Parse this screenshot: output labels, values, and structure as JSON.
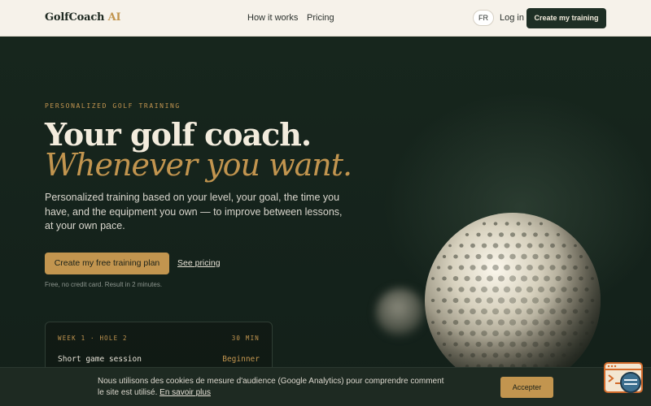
{
  "nav": {
    "logo_main": "GolfCoach",
    "logo_ai": "AI",
    "links": [
      "How it works",
      "Pricing"
    ],
    "lang": "FR",
    "login": "Log in",
    "cta": "Create my training"
  },
  "hero": {
    "eyebrow": "PERSONALIZED GOLF TRAINING",
    "title_line1": "Your golf coach.",
    "title_line2": "Whenever you want.",
    "subtitle": "Personalized training based on your level, your goal, the time you have, and the equipment you own — to improve between lessons, at your own pace.",
    "cta_primary": "Create my free training plan",
    "cta_secondary": "See pricing",
    "note": "Free, no credit card. Result in 2 minutes."
  },
  "session_card": {
    "week": "WEEK 1 · HOLE 2",
    "duration": "30 MIN",
    "session": "Short game session",
    "level": "Beginner"
  },
  "cookie": {
    "text": "Nous utilisons des cookies de mesure d'audience (Google Analytics) pour comprendre comment le site est utilisé.",
    "link": "En savoir plus",
    "accept": "Accepter"
  },
  "icons": {
    "golf_ball": "golf-ball-image",
    "support": "chat-widget-icon"
  },
  "colors": {
    "accent": "#c2954f",
    "dark": "#1e2f25",
    "nav_bg": "#f6f2ea"
  }
}
